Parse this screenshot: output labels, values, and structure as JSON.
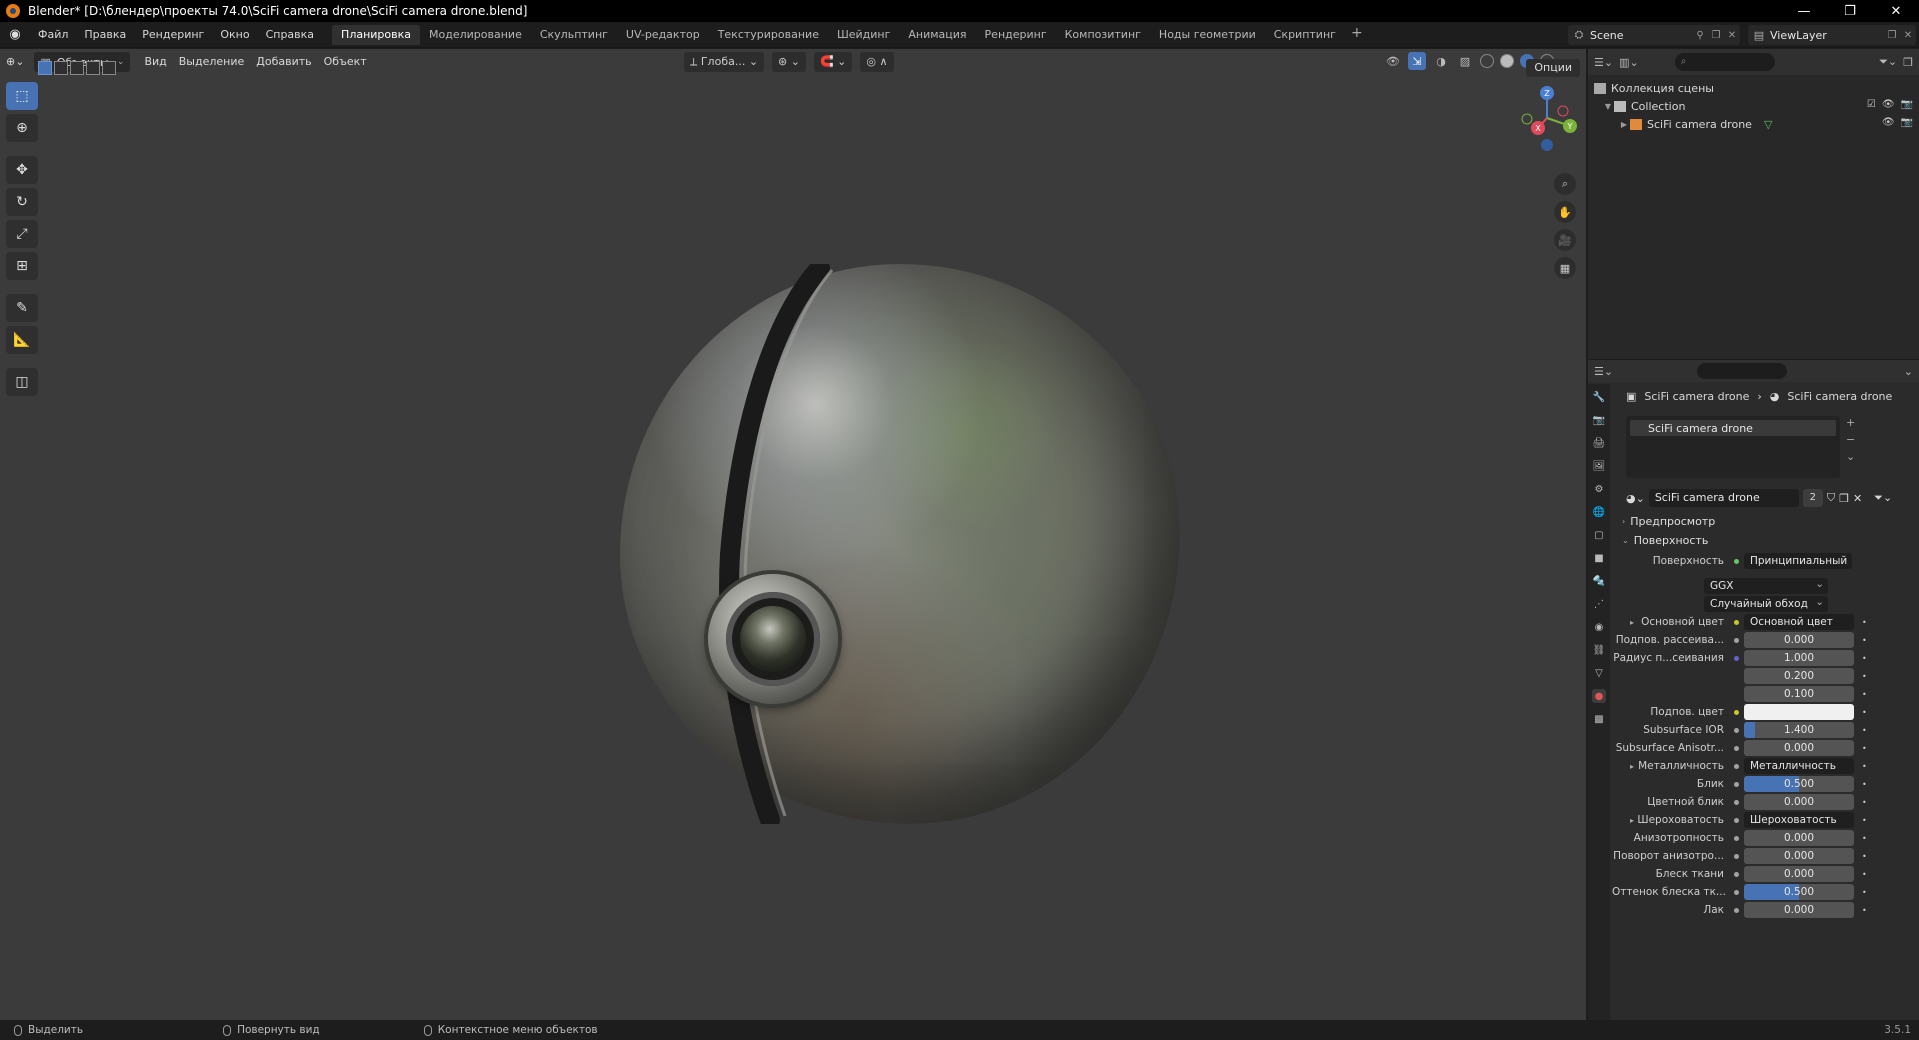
{
  "window": {
    "title": "Blender* [D:\\блендер\\проекты 74.0\\SciFi camera drone\\SciFi camera drone.blend]",
    "controls": [
      "—",
      "❐",
      "✕"
    ]
  },
  "menu": {
    "items": [
      "Файл",
      "Правка",
      "Рендеринг",
      "Окно",
      "Справка"
    ]
  },
  "workspaces": {
    "tabs": [
      "Планировка",
      "Моделирование",
      "Скульптинг",
      "UV-редактор",
      "Текстурирование",
      "Шейдинг",
      "Анимация",
      "Рендеринг",
      "Композитинг",
      "Ноды геометрии",
      "Скриптинг"
    ],
    "active": "Планировка",
    "add": "+"
  },
  "scene": {
    "name": "Scene",
    "view_layer": "ViewLayer"
  },
  "viewport": {
    "mode": "Объекты",
    "menus": [
      "Вид",
      "Выделение",
      "Добавить",
      "Объект"
    ],
    "orientation": "Глоба...",
    "options": "Опции",
    "gizmo_axes": {
      "z": "Z",
      "y": "Y",
      "x": "X"
    }
  },
  "outliner": {
    "root": "Коллекция сцены",
    "collection": "Collection",
    "object": "SciFi camera drone"
  },
  "properties": {
    "breadcrumb": [
      "SciFi camera drone",
      "SciFi camera drone"
    ],
    "slot": "SciFi camera drone",
    "material_name": "SciFi camera drone",
    "material_users": "2",
    "panels": {
      "preview": "Предпросмотр",
      "surface": "Поверхность"
    },
    "surface_shader_label": "Поверхность",
    "surface_shader": "Принципиальный BSDF",
    "distribution": "GGX",
    "subsurface_method": "Случайный обход",
    "rows": [
      {
        "label": "Основной цвет",
        "value": "Основной цвет",
        "kind": "link",
        "socket": "yellow",
        "expand": true
      },
      {
        "label": "Подпов. рассеива...",
        "value": "0.000",
        "kind": "num",
        "socket": "grey"
      },
      {
        "label": "Радиус п...сеивания",
        "value": "1.000",
        "kind": "num",
        "socket": "blue"
      },
      {
        "label": "",
        "value": "0.200",
        "kind": "num",
        "socket": "none"
      },
      {
        "label": "",
        "value": "0.100",
        "kind": "num",
        "socket": "none"
      },
      {
        "label": "Подпов. цвет",
        "value": "",
        "kind": "color",
        "socket": "yellow"
      },
      {
        "label": "Subsurface IOR",
        "value": "1.400",
        "kind": "num",
        "socket": "grey",
        "fill": 0.1
      },
      {
        "label": "Subsurface Anisotr...",
        "value": "0.000",
        "kind": "num",
        "socket": "grey"
      },
      {
        "label": "Металличность",
        "value": "Металличность",
        "kind": "link",
        "socket": "grey",
        "expand": true
      },
      {
        "label": "Блик",
        "value": "0.500",
        "kind": "num",
        "socket": "grey",
        "fill": 0.5
      },
      {
        "label": "Цветной блик",
        "value": "0.000",
        "kind": "num",
        "socket": "grey"
      },
      {
        "label": "Шероховатость",
        "value": "Шероховатость",
        "kind": "link",
        "socket": "grey",
        "expand": true
      },
      {
        "label": "Анизотропность",
        "value": "0.000",
        "kind": "num",
        "socket": "grey"
      },
      {
        "label": "Поворот анизотро...",
        "value": "0.000",
        "kind": "num",
        "socket": "grey"
      },
      {
        "label": "Блеск ткани",
        "value": "0.000",
        "kind": "num",
        "socket": "grey"
      },
      {
        "label": "Оттенок блеска тк...",
        "value": "0.500",
        "kind": "num",
        "socket": "grey",
        "fill": 0.5
      },
      {
        "label": "Лак",
        "value": "0.000",
        "kind": "num",
        "socket": "grey"
      }
    ]
  },
  "status": {
    "select": "Выделить",
    "rotate": "Повернуть вид",
    "context": "Контекстное меню объектов",
    "version": "3.5.1"
  },
  "colors": {
    "accent": "#4772b3",
    "viewport_bg": "#3b3b3b"
  }
}
